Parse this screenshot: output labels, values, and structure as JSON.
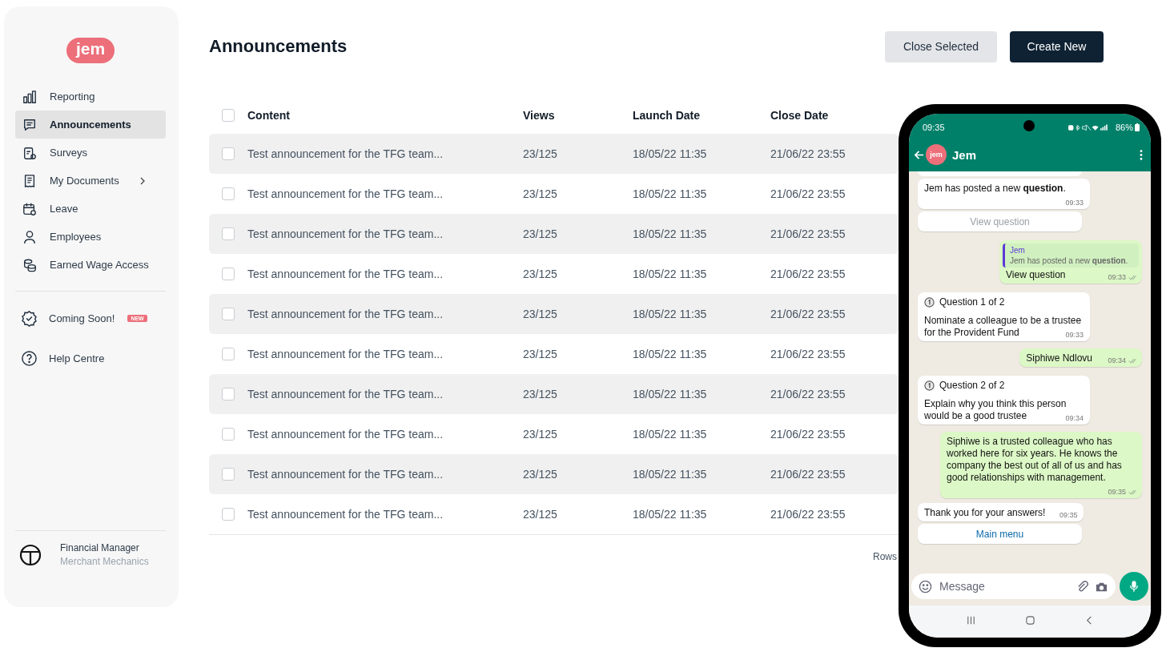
{
  "sidebar": {
    "logo": "jem",
    "nav": [
      {
        "label": "Reporting",
        "selected": false,
        "submenu": false
      },
      {
        "label": "Announcements",
        "selected": true,
        "submenu": false
      },
      {
        "label": "Surveys",
        "selected": false,
        "submenu": false
      },
      {
        "label": "My Documents",
        "selected": false,
        "submenu": true
      },
      {
        "label": "Leave",
        "selected": false,
        "submenu": false
      },
      {
        "label": "Employees",
        "selected": false,
        "submenu": false
      },
      {
        "label": "Earned Wage Access",
        "selected": false,
        "submenu": false
      }
    ],
    "extra": [
      {
        "label": "Coming Soon!",
        "badge": "NEW"
      },
      {
        "label": "Help Centre"
      }
    ],
    "user": {
      "role": "Financial Manager",
      "company": "Merchant Mechanics"
    }
  },
  "header": {
    "title": "Announcements",
    "buttons": [
      {
        "label": "Close Selected",
        "kind": "secondary"
      },
      {
        "label": "Create New",
        "kind": "primary"
      }
    ]
  },
  "table": {
    "select_all_checked": false,
    "columns": [
      "Content",
      "Views",
      "Launch Date",
      "Close Date"
    ],
    "rows": [
      {
        "content": "Test announcement for the TFG team...",
        "views": "23/125",
        "launch": "18/05/22 11:35",
        "close": "21/06/22 23:55",
        "checked": false
      },
      {
        "content": "Test announcement for the TFG team...",
        "views": "23/125",
        "launch": "18/05/22 11:35",
        "close": "21/06/22 23:55",
        "checked": false
      },
      {
        "content": "Test announcement for the TFG team...",
        "views": "23/125",
        "launch": "18/05/22 11:35",
        "close": "21/06/22 23:55",
        "checked": false
      },
      {
        "content": "Test announcement for the TFG team...",
        "views": "23/125",
        "launch": "18/05/22 11:35",
        "close": "21/06/22 23:55",
        "checked": false
      },
      {
        "content": "Test announcement for the TFG team...",
        "views": "23/125",
        "launch": "18/05/22 11:35",
        "close": "21/06/22 23:55",
        "checked": false
      },
      {
        "content": "Test announcement for the TFG team...",
        "views": "23/125",
        "launch": "18/05/22 11:35",
        "close": "21/06/22 23:55",
        "checked": false
      },
      {
        "content": "Test announcement for the TFG team...",
        "views": "23/125",
        "launch": "18/05/22 11:35",
        "close": "21/06/22 23:55",
        "checked": false
      },
      {
        "content": "Test announcement for the TFG team...",
        "views": "23/125",
        "launch": "18/05/22 11:35",
        "close": "21/06/22 23:55",
        "checked": false
      },
      {
        "content": "Test announcement for the TFG team...",
        "views": "23/125",
        "launch": "18/05/22 11:35",
        "close": "21/06/22 23:55",
        "checked": false
      },
      {
        "content": "Test announcement for the TFG team...",
        "views": "23/125",
        "launch": "18/05/22 11:35",
        "close": "21/06/22 23:55",
        "checked": false
      }
    ]
  },
  "pagination": {
    "label": "Rows"
  },
  "phone": {
    "status": {
      "time": "09:35",
      "battery": "86%"
    },
    "chat": {
      "avatar": "jem",
      "name": "Jem"
    },
    "messages": [
      {
        "kind": "incoming",
        "text": "Jem has posted a new **question**.",
        "time": "09:33"
      },
      {
        "kind": "action",
        "label": "View question",
        "disabled": true
      },
      {
        "kind": "reply",
        "quote_author": "Jem",
        "quote_text": "Jem has posted a new **question**.",
        "text": "View question",
        "time": "09:33"
      },
      {
        "kind": "question",
        "heading": "Question 1 of 2",
        "text": "Nominate a colleague to be a trustee for the Provident Fund",
        "time": "09:33"
      },
      {
        "kind": "outgoing",
        "text": "Siphiwe Ndlovu",
        "time": "09:34"
      },
      {
        "kind": "question",
        "heading": "Question 2 of 2",
        "text": "Explain why you think this person would be a good trustee",
        "time": "09:34"
      },
      {
        "kind": "outgoing",
        "text": "Siphiwe is a trusted colleague who has worked here for six years. He knows the company the best out of all of us and has good relationships with management.",
        "time": "09:35"
      },
      {
        "kind": "incoming",
        "text": "Thank you for your answers!",
        "time": "09:35"
      },
      {
        "kind": "action",
        "label": "Main menu",
        "disabled": false
      }
    ],
    "composer": {
      "placeholder": "Message"
    }
  }
}
